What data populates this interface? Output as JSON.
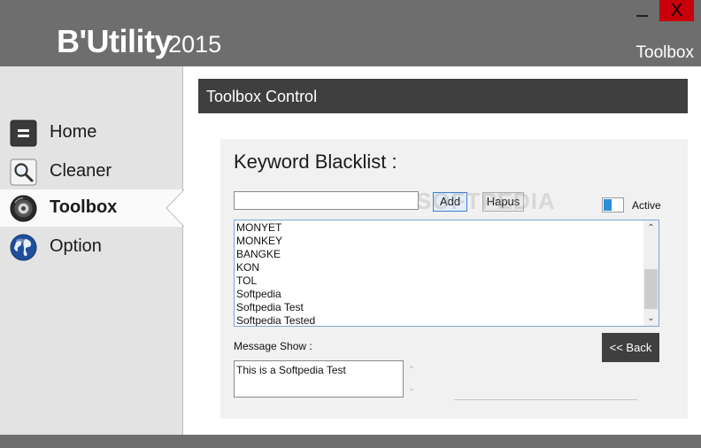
{
  "app": {
    "title_main": "B'Utility",
    "title_year": "2015",
    "section": "Toolbox",
    "minimize_label": "",
    "close_label": "X"
  },
  "sidebar": {
    "items": [
      {
        "label": "Home",
        "icon": "home-icon",
        "active": false
      },
      {
        "label": "Cleaner",
        "icon": "magnifier-icon",
        "active": false
      },
      {
        "label": "Toolbox",
        "icon": "toolbox-disc-icon",
        "active": true
      },
      {
        "label": "Option",
        "icon": "globe-icon",
        "active": false
      }
    ]
  },
  "panel": {
    "header": "Toolbox Control",
    "title": "Keyword Blacklist  :",
    "keyword_input_value": "",
    "add_label": "Add",
    "hapus_label": "Hapus",
    "watermark": "SOFTPEDIA",
    "toggle_label": "Active",
    "toggle_on": true,
    "keywords": [
      "MONYET",
      "MONKEY",
      "BANGKE",
      "KON",
      "TOL",
      "Softpedia",
      "Softpedia Test",
      "Softpedia Tested"
    ],
    "message_label": "Message Show :",
    "message_value": "This is a Softpedia Test",
    "back_label": "<< Back"
  },
  "colors": {
    "header_bg": "#6e6e6e",
    "panel_header_bg": "#3f3f3f",
    "close_bg": "#c8000c",
    "toggle_accent": "#2b8fd9",
    "sidebar_bg": "#e3e3e3"
  }
}
